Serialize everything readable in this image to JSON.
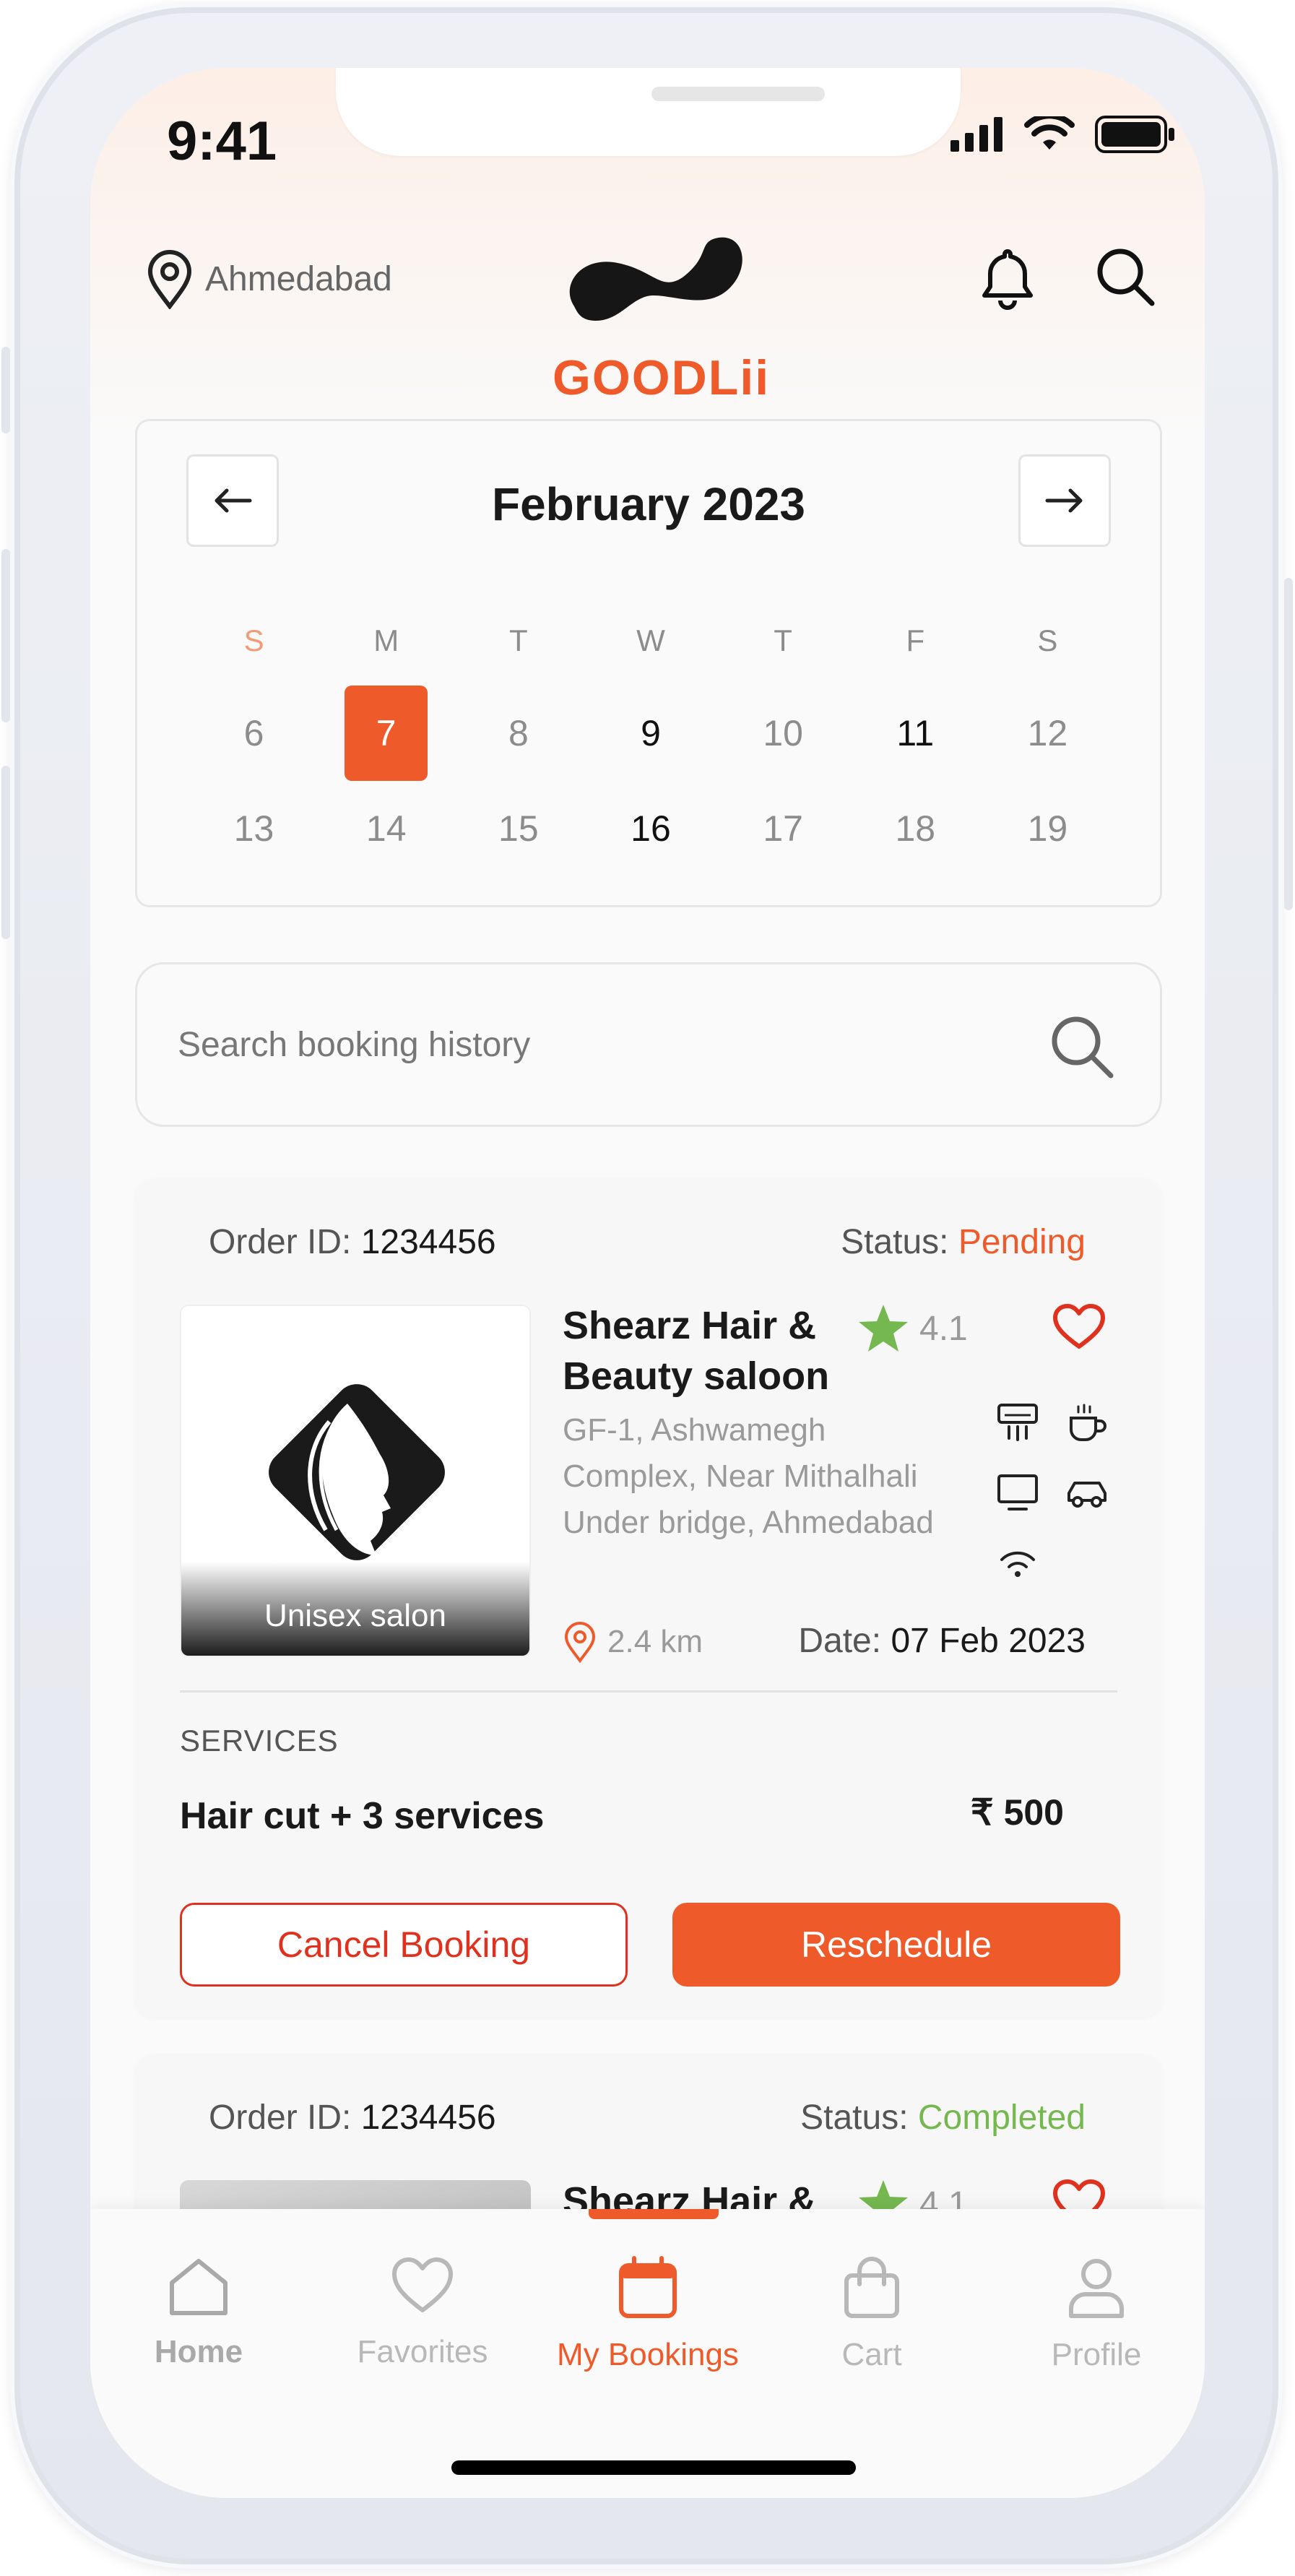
{
  "status_bar": {
    "time": "9:41"
  },
  "header": {
    "location": "Ahmedabad",
    "logo_text": "GOODLii",
    "icons": [
      "location-pin-icon",
      "bell-icon",
      "search-icon"
    ]
  },
  "calendar": {
    "month_label": "February 2023",
    "day_names": [
      "S",
      "M",
      "T",
      "W",
      "T",
      "F",
      "S"
    ],
    "week1": [
      "6",
      "7",
      "8",
      "9",
      "10",
      "11",
      "12"
    ],
    "week2": [
      "13",
      "14",
      "15",
      "16",
      "17",
      "18",
      "19"
    ],
    "selected_day": "7"
  },
  "history_search": {
    "placeholder": "Search booking history"
  },
  "bookings": [
    {
      "order_label": "Order ID:",
      "order_id": "1234456",
      "status_label": "Status:",
      "status": "Pending",
      "salon_name": "Shearz Hair & Beauty saloon",
      "rating": "4.1",
      "address": "GF-1, Ashwamegh Complex, Near Mithalhali Under bridge, Ahmedabad",
      "thumb_label": "Unisex salon",
      "distance": "2.4 km",
      "date_label": "Date:",
      "date": "07 Feb 2023",
      "services_heading": "SERVICES",
      "services": "Hair cut + 3 services",
      "price": "₹ 500",
      "cancel_label": "Cancel Booking",
      "reschedule_label": "Reschedule",
      "amenities": [
        "ac-icon",
        "coffee-icon",
        "tv-icon",
        "car-icon",
        "wifi-icon"
      ]
    },
    {
      "order_label": "Order ID:",
      "order_id": "1234456",
      "status_label": "Status:",
      "status": "Completed",
      "salon_name": "Shearz Hair &",
      "rating": "4.1"
    }
  ],
  "bottom_nav": {
    "items": [
      {
        "label": "Home",
        "icon": "home-icon"
      },
      {
        "label": "Favorites",
        "icon": "heart-icon"
      },
      {
        "label": "My Bookings",
        "icon": "calendar-icon"
      },
      {
        "label": "Cart",
        "icon": "bag-icon"
      },
      {
        "label": "Profile",
        "icon": "user-icon"
      }
    ],
    "active": "My Bookings"
  },
  "colors": {
    "accent": "#ef5a2a",
    "cancel": "#e0311f",
    "completed": "#75b84f",
    "star": "#75b84f"
  }
}
